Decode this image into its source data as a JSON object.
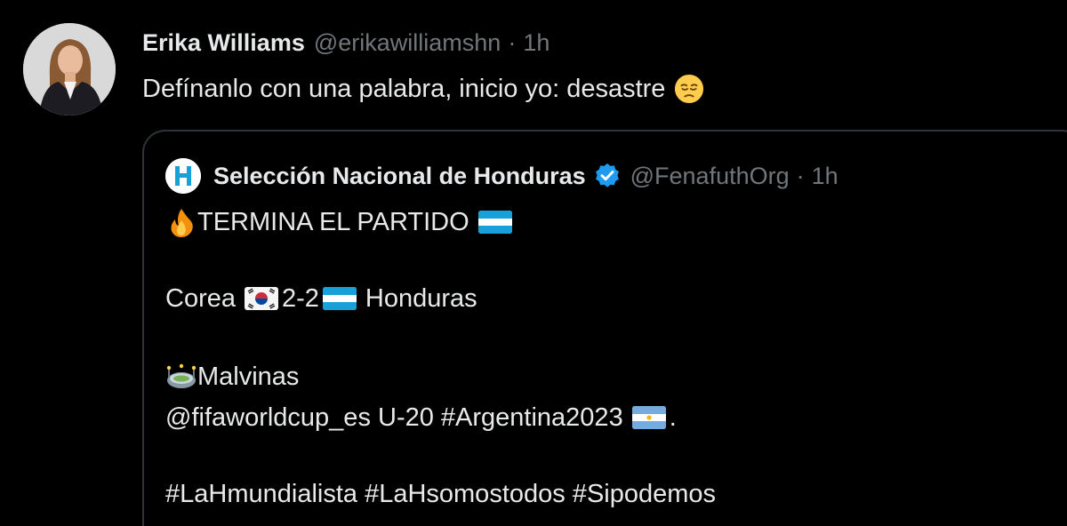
{
  "tweet": {
    "author_name": "Erika Williams",
    "author_handle": "@erikawilliamshn",
    "separator": "·",
    "time": "1h",
    "text": "Defínanlo con una palabra, inicio yo: desastre",
    "avatar_icon": "profile-photo",
    "emoji": "pensive-face-emoji"
  },
  "quote": {
    "author_name": "Selección Nacional de Honduras",
    "author_handle": "@FenafuthOrg",
    "separator": "·",
    "time": "1h",
    "verified_icon": "verified-badge-icon",
    "lines": {
      "l1": "TERMINA EL PARTIDO",
      "l2a": "Corea",
      "l2b": "2-2",
      "l2c": "Honduras",
      "l3": "Malvinas",
      "l4a": "@fifaworldcup_es U-20 #Argentina2023",
      "l4b": ".",
      "l5": "#LaHmundialista #LaHsomostodos #Sipodemos"
    }
  },
  "colors": {
    "background": "#000000",
    "primary_text": "#e7e9ea",
    "secondary_text": "#71767b",
    "border": "#2f3336",
    "verified": "#1d9bf0",
    "honduras_blue": "#18a0d8"
  }
}
